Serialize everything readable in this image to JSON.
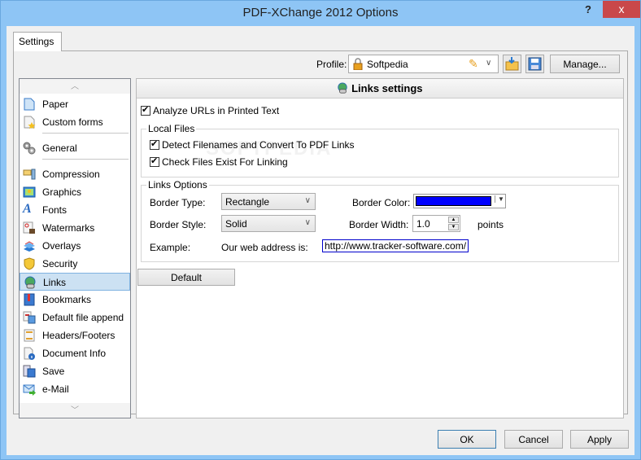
{
  "window": {
    "title": "PDF-XChange 2012 Options",
    "help_label": "?",
    "close_label": "x"
  },
  "tabs": [
    {
      "label": "Settings"
    }
  ],
  "profile": {
    "label": "Profile:",
    "value": "Softpedia",
    "manage_label": "Manage..."
  },
  "sidebar": {
    "items": [
      {
        "label": "Paper",
        "icon": "paper-icon"
      },
      {
        "label": "Custom forms",
        "icon": "custom-forms-icon"
      },
      {
        "label": "General",
        "icon": "gears-icon"
      },
      {
        "label": "Compression",
        "icon": "compression-icon"
      },
      {
        "label": "Graphics",
        "icon": "graphics-icon"
      },
      {
        "label": "Fonts",
        "icon": "fonts-icon"
      },
      {
        "label": "Watermarks",
        "icon": "watermarks-icon"
      },
      {
        "label": "Overlays",
        "icon": "overlays-icon"
      },
      {
        "label": "Security",
        "icon": "shield-icon"
      },
      {
        "label": "Links",
        "icon": "globe-link-icon",
        "selected": true
      },
      {
        "label": "Bookmarks",
        "icon": "bookmarks-icon"
      },
      {
        "label": "Default file append",
        "icon": "file-append-icon"
      },
      {
        "label": "Headers/Footers",
        "icon": "headers-footers-icon"
      },
      {
        "label": "Document Info",
        "icon": "document-info-icon"
      },
      {
        "label": "Save",
        "icon": "save-icon"
      },
      {
        "label": "e-Mail",
        "icon": "email-icon"
      }
    ],
    "scroll_up": "︿",
    "scroll_down": "﹀"
  },
  "content": {
    "header": "Links settings",
    "analyze_urls": {
      "label": "Analyze URLs in Printed Text",
      "checked": true
    },
    "local_files": {
      "title": "Local Files",
      "detect_filenames": {
        "label": "Detect Filenames and Convert To PDF Links",
        "checked": true
      },
      "check_files": {
        "label": "Check Files Exist For Linking",
        "checked": true
      }
    },
    "links_options": {
      "title": "Links Options",
      "border_type_label": "Border Type:",
      "border_type_value": "Rectangle",
      "border_style_label": "Border Style:",
      "border_style_value": "Solid",
      "border_color_label": "Border Color:",
      "border_color_value": "#0000ff",
      "border_width_label": "Border Width:",
      "border_width_value": "1.0",
      "border_width_unit": "points",
      "example_label": "Example:",
      "example_text": "Our web address is:",
      "example_link": "http://www.tracker-software.com/"
    },
    "default_label": "Default",
    "watermark": "SOFTPEDIA"
  },
  "footer": {
    "ok_label": "OK",
    "cancel_label": "Cancel",
    "apply_label": "Apply"
  }
}
